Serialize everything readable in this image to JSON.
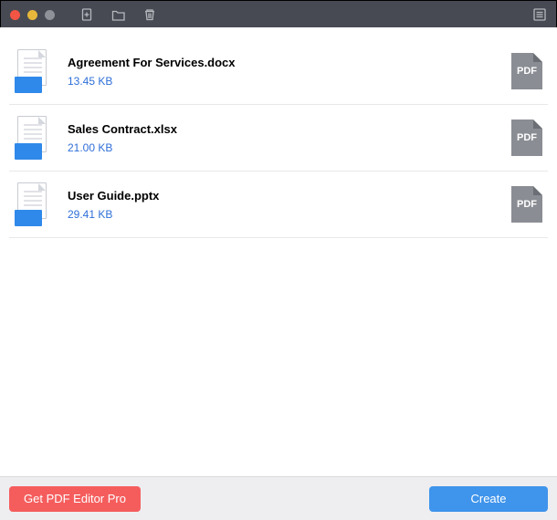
{
  "files": [
    {
      "name": "Agreement For Services.docx",
      "size": "13.45 KB"
    },
    {
      "name": "Sales Contract.xlsx",
      "size": "21.00 KB"
    },
    {
      "name": "User Guide.pptx",
      "size": "29.41 KB"
    }
  ],
  "pdf_badge": "PDF",
  "footer": {
    "pro_label": "Get PDF Editor Pro",
    "create_label": "Create"
  }
}
